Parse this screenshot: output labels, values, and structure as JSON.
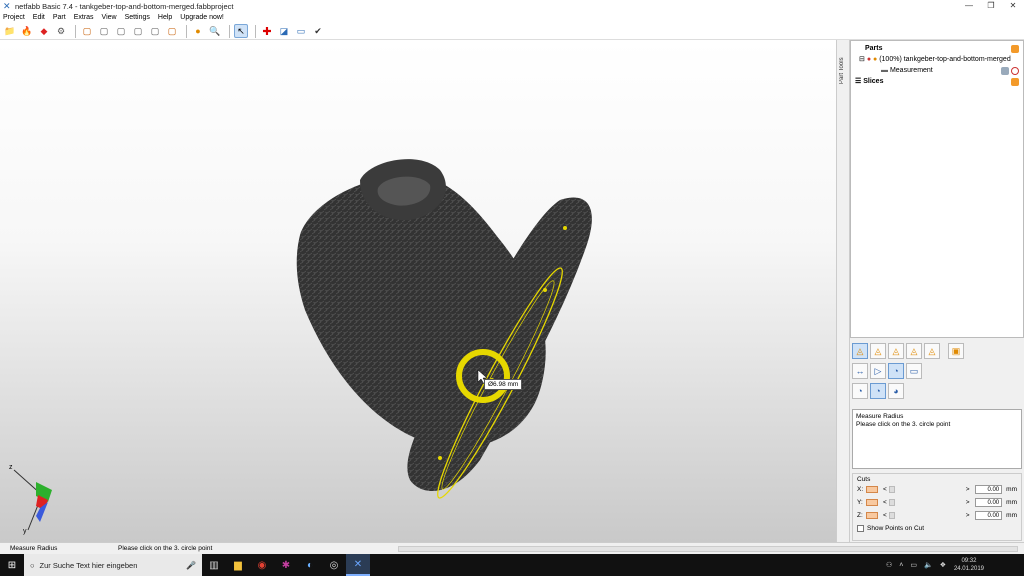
{
  "window": {
    "title": "netfabb Basic 7.4 - tankgeber-top-and-bottom-merged.fabbproject",
    "controls": {
      "minimize": "—",
      "maximize": "❐",
      "close": "✕"
    }
  },
  "menu": [
    "Project",
    "Edit",
    "Part",
    "Extras",
    "View",
    "Settings",
    "Help",
    "Upgrade now!"
  ],
  "toolbar": {
    "groups": [
      [
        "new-project-icon",
        "open-icon",
        "import-part-icon",
        "settings-icon"
      ],
      [
        "view-front-icon",
        "view-back-icon",
        "view-left-icon",
        "view-right-icon",
        "view-top-icon",
        "view-bottom-icon"
      ],
      [
        "sphere-icon",
        "zoom-icon"
      ],
      [
        "select-cursor-icon"
      ],
      [
        "repair-icon",
        "cut-icon",
        "measure-icon",
        "check-icon"
      ]
    ],
    "glyphs": {
      "new": "📁",
      "open": "🔥",
      "import": "◆",
      "settings": "⚙",
      "cube": "▢",
      "sphere": "●",
      "zoom": "🔍",
      "cursor": "↖",
      "repair": "✚",
      "cut": "◪",
      "measure": "▭",
      "check": "✔"
    }
  },
  "viewport": {
    "measurement_label": "Ø6.98 mm",
    "axes": {
      "x": "x",
      "y": "y",
      "z": "z"
    }
  },
  "side_tab": "Part Tools",
  "tree": {
    "parts_label": "Parts",
    "part_item": "(100%) tankgeber-top-and-bottom-merged",
    "measurement": "Measurement",
    "slices": "Slices"
  },
  "message": {
    "line1": "Measure Radius",
    "line2": "Please click on the 3. circle point"
  },
  "cuts": {
    "title": "Cuts",
    "rows": [
      {
        "axis": "X:",
        "value": "0.00",
        "unit": "mm"
      },
      {
        "axis": "Y:",
        "value": "0.00",
        "unit": "mm"
      },
      {
        "axis": "Z:",
        "value": "0.00",
        "unit": "mm"
      }
    ],
    "lt": "<",
    "gt": ">",
    "checkbox": "Show Points on Cut"
  },
  "status": {
    "left": "Measure Radius",
    "right": "Please click on the 3. circle point"
  },
  "taskbar": {
    "search_placeholder": "Zur Suche Text hier eingeben",
    "time": "09:32",
    "date": "24.01.2019"
  },
  "colors": {
    "accent_yellow": "#e6d800",
    "model_dark": "#2e2e2e",
    "selection_blue": "#cfe2f7"
  }
}
